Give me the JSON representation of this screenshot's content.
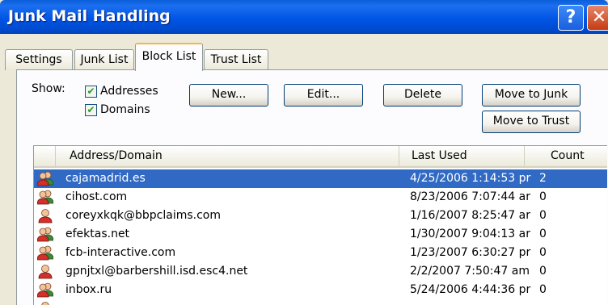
{
  "window": {
    "title": "Junk Mail Handling",
    "help_label": "?",
    "close_label": "✕"
  },
  "tabs": [
    {
      "label": "Settings",
      "active": false
    },
    {
      "label": "Junk List",
      "active": false
    },
    {
      "label": "Block List",
      "active": true
    },
    {
      "label": "Trust List",
      "active": false
    }
  ],
  "show": {
    "label": "Show:",
    "addresses": {
      "label": "Addresses",
      "checked": true
    },
    "domains": {
      "label": "Domains",
      "checked": true
    }
  },
  "buttons": {
    "new": "New...",
    "edit": "Edit...",
    "delete": "Delete",
    "move_to_junk": "Move to Junk",
    "move_to_trust": "Move to Trust"
  },
  "list": {
    "columns": {
      "address": "Address/Domain",
      "last_used": "Last Used",
      "count": "Count"
    },
    "rows": [
      {
        "icon": "domain-icon",
        "address": "cajamadrid.es",
        "last_used": "4/25/2006 1:14:53 pr",
        "count": "2",
        "selected": true
      },
      {
        "icon": "domain-icon",
        "address": "cihost.com",
        "last_used": "8/23/2006 7:07:44 ar",
        "count": "0",
        "selected": false
      },
      {
        "icon": "address-icon",
        "address": "coreyxkqk@bbpclaims.com",
        "last_used": "1/16/2007 8:25:47 ar",
        "count": "0",
        "selected": false
      },
      {
        "icon": "domain-icon",
        "address": "efektas.net",
        "last_used": "1/30/2007 9:04:13 ar",
        "count": "0",
        "selected": false
      },
      {
        "icon": "domain-icon",
        "address": "fcb-interactive.com",
        "last_used": "1/23/2007 6:30:27 pr",
        "count": "0",
        "selected": false
      },
      {
        "icon": "address-icon",
        "address": "gpnjtxl@barbershill.isd.esc4.net",
        "last_used": "2/2/2007 7:50:47 am",
        "count": "0",
        "selected": false
      },
      {
        "icon": "domain-icon",
        "address": "inbox.ru",
        "last_used": "5/24/2006 4:44:36 pr",
        "count": "0",
        "selected": false
      }
    ]
  },
  "colors": {
    "titlebar": "#0055e5",
    "selection": "#316ac5",
    "active_tab_accent": "#f7b642"
  }
}
